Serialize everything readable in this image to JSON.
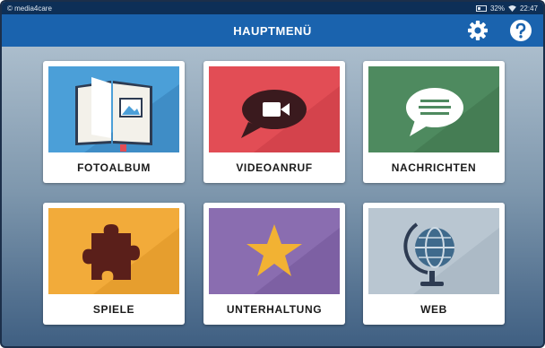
{
  "status_bar": {
    "brand": "© media4care",
    "battery": "32%",
    "time": "22:47"
  },
  "app_bar": {
    "title": "HAUPTMENÜ",
    "settings_icon": "gear-icon",
    "help_icon": "question-mark-icon"
  },
  "tiles": [
    {
      "label": "FOTOALBUM",
      "icon": "photo-album-icon",
      "color": "#4b9fd8"
    },
    {
      "label": "VIDEOANRUF",
      "icon": "video-call-icon",
      "color": "#e24d55"
    },
    {
      "label": "NACHRICHTEN",
      "icon": "message-icon",
      "color": "#4e8a5f"
    },
    {
      "label": "SPIELE",
      "icon": "puzzle-icon",
      "color": "#f2ab3a"
    },
    {
      "label": "UNTERHALTUNG",
      "icon": "star-icon",
      "color": "#8a6db0"
    },
    {
      "label": "WEB",
      "icon": "globe-icon",
      "color": "#b9c6d1"
    }
  ],
  "colors": {
    "app_bar": "#1a63ae",
    "status_bar": "#0d2f57"
  }
}
